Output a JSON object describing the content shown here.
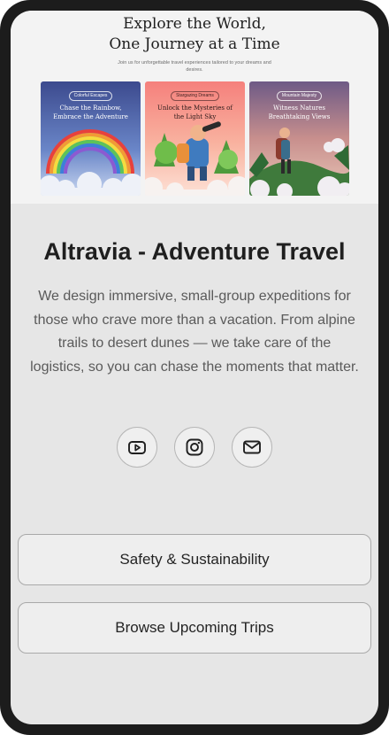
{
  "hero": {
    "title_line1": "Explore the World,",
    "title_line2": "One Journey at a Time",
    "subtitle": "Join us for unforgettable travel experiences tailored to your dreams and desires.",
    "cards": [
      {
        "tag": "Colorful Escapes",
        "line1": "Chase the Rainbow,",
        "line2": "Embrace the Adventure"
      },
      {
        "tag": "Stargazing Dreams",
        "line1": "Unlock the Mysteries of",
        "line2": "the Light Sky"
      },
      {
        "tag": "Mountain Majesty",
        "line1": "Witness Natures",
        "line2": "Breathtaking Views"
      }
    ]
  },
  "profile": {
    "name": "Altravia - Adventure Travel",
    "description": "We design immersive, small-group expeditions for those who crave more than a vacation. From alpine trails to desert dunes — we take care of the logistics, so you can chase the moments that matter."
  },
  "socials": [
    {
      "icon": "youtube-icon"
    },
    {
      "icon": "instagram-icon"
    },
    {
      "icon": "mail-icon"
    }
  ],
  "links": [
    {
      "label": "Safety & Sustainability"
    },
    {
      "label": "Browse Upcoming Trips"
    }
  ],
  "colors": {
    "frame": "#1c1c1c",
    "background": "#e6e6e6",
    "button_border": "#a9a9a9"
  }
}
